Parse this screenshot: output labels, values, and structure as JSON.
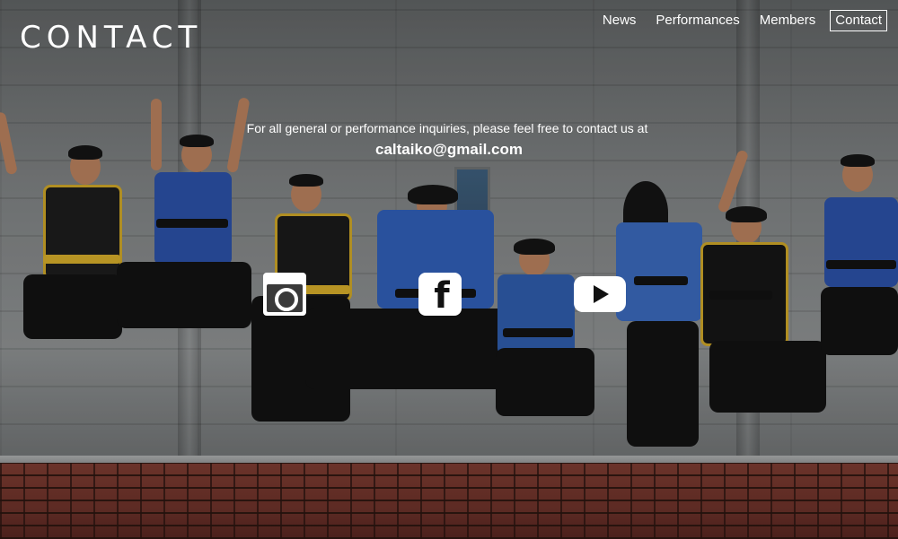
{
  "header": {
    "title": "CONTACT",
    "nav": [
      {
        "label": "News",
        "active": false
      },
      {
        "label": "Performances",
        "active": false
      },
      {
        "label": "Members",
        "active": false
      },
      {
        "label": "Contact",
        "active": true
      }
    ]
  },
  "contact": {
    "intro": "For all general or performance inquiries, please feel free to contact us at",
    "email": "caltaiko@gmail.com"
  },
  "social": {
    "icons": [
      "instagram-icon",
      "facebook-icon",
      "youtube-icon"
    ],
    "facebook_glyph": "f"
  },
  "colors": {
    "text": "#ffffff",
    "icon_bg": "#ffffff",
    "icon_fg": "#111111"
  }
}
